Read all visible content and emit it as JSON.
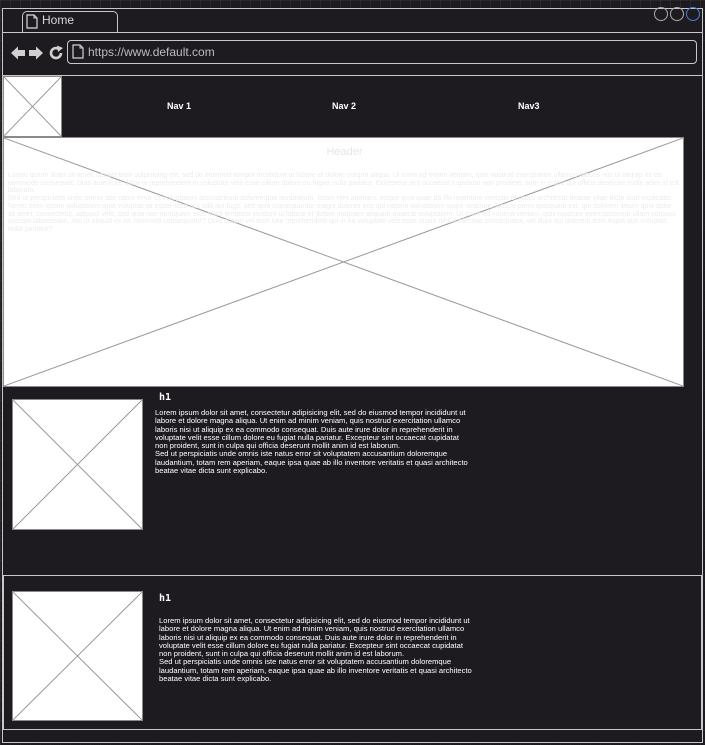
{
  "browser": {
    "tab_label": "Home",
    "url": "https://www.default.com"
  },
  "nav": {
    "items": [
      {
        "label": "Nav 1"
      },
      {
        "label": "Nav 2"
      },
      {
        "label": "Nav3"
      }
    ]
  },
  "hero": {
    "title": "Header",
    "paragraph1": "Lorem ipsum dolor sit amet, consectetur adipisicing elit, sed do eiusmod tempor incididunt ut labore et dolore magna aliqua. Ut enim ad minim veniam, quis nostrud exercitation ullamco laboris nisi ut aliquip ex ea commodo consequat. Duis aute irure dolor in reprehenderit in voluptate velit esse cillum dolore eu fugiat nulla pariatur. Excepteur sint occaecat cupidatat non proident, sunt in culpa qui officia deserunt mollit anim id est laborum.",
    "paragraph2": "Sed ut perspiciatis unde omnis iste natus error sit voluptatem accusantium doloremque laudantium, totam rem aperiam, eaque ipsa quae ab illo inventore veritatis et quasi architecto beatae vitae dicta sunt explicabo. Nemo enim ipsam voluptatem quia voluptas sit aspernatur aut odit aut fugit, sed quia consequuntur magni dolores eos qui ratione voluptatem sequi nesciunt. Neque porro quisquam est, qui dolorem ipsum quia dolor sit amet, consectetur, adipisci velit, sed quia non numquam eius modi tempora incidunt ut labore et dolore magnam aliquam quaerat voluptatem. Ut enim ad minima veniam, quis nostrum exercitationem ullam corporis suscipit laboriosam, nisi ut aliquid ex ea commodi consequatur? Quis autem vel eum iure reprehenderit qui in ea voluptate velit esse quam nihil molestiae consequatur, vel illum qui dolorem eum fugiat quo voluptas nulla pariatur?"
  },
  "sections": [
    {
      "heading": "h1",
      "paragraph1": "Lorem ipsum dolor sit amet, consectetur adipisicing elit, sed do eiusmod tempor incididunt ut labore et dolore magna aliqua. Ut enim ad minim veniam, quis nostrud exercitation ullamco laboris nisi ut aliquip ex ea commodo consequat. Duis aute irure dolor in reprehenderit in voluptate velit esse cillum dolore eu fugiat nulla pariatur. Excepteur sint occaecat cupidatat non proident, sunt in culpa qui officia deserunt mollit anim id est laborum.",
      "paragraph2": "Sed ut perspiciatis unde omnis iste natus error sit voluptatem accusantium doloremque laudantium, totam rem aperiam, eaque ipsa quae ab illo inventore veritatis et quasi architecto beatae vitae dicta sunt explicabo."
    },
    {
      "heading": "h1",
      "paragraph1": "Lorem ipsum dolor sit amet, consectetur adipisicing elit, sed do eiusmod tempor incididunt ut labore et dolore magna aliqua. Ut enim ad minim veniam, quis nostrud exercitation ullamco laboris nisi ut aliquip ex ea commodo consequat. Duis aute irure dolor in reprehenderit in voluptate velit esse cillum dolore eu fugiat nulla pariatur. Excepteur sint occaecat cupidatat non proident, sunt in culpa qui officia deserunt mollit anim id est laborum.",
      "paragraph2": "Sed ut perspiciatis unde omnis iste natus error sit voluptatem accusantium doloremque laudantium, totam rem aperiam, eaque ipsa quae ab illo inventore veritatis et quasi architecto beatae vitae dicta sunt explicabo."
    }
  ],
  "icons": {
    "tab": "page-icon",
    "back": "back-arrow-icon",
    "forward": "forward-arrow-icon",
    "reload": "reload-icon",
    "address": "page-icon",
    "window_controls": [
      "window-control-icon",
      "window-control-icon",
      "window-control-icon"
    ],
    "placeholders": "image-placeholder-icon"
  },
  "colors": {
    "background": "#1e1b20",
    "outline": "#c8c8c8",
    "placeholder_fill": "#ffffff",
    "active_control": "#4a7fd4"
  }
}
